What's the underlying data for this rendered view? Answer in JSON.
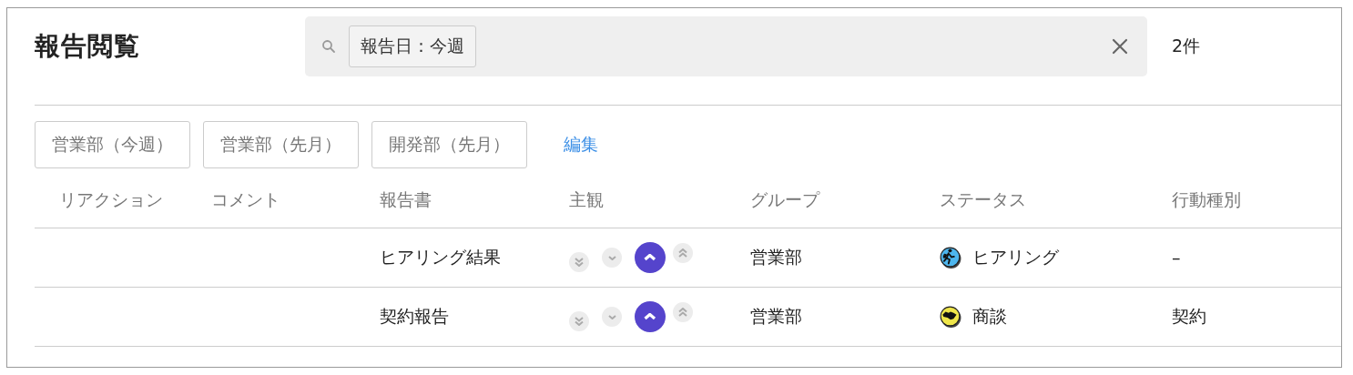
{
  "title": "報告閲覧",
  "search": {
    "chips": [
      "報告日：今週"
    ]
  },
  "result_count": "2件",
  "saved_filters": [
    "営業部（今週）",
    "営業部（先月）",
    "開発部（先月）"
  ],
  "edit_link": "編集",
  "table": {
    "columns": [
      "リアクション",
      "コメント",
      "報告書",
      "主観",
      "グループ",
      "ステータス",
      "行動種別"
    ],
    "rows": [
      {
        "report": "ヒアリング結果",
        "opinion": [
          {
            "kind": "double-down",
            "selected": false
          },
          {
            "kind": "down",
            "selected": false
          },
          {
            "kind": "up",
            "selected": true
          },
          {
            "kind": "double-up",
            "selected": false
          }
        ],
        "group": "営業部",
        "status": {
          "label": "ヒアリング",
          "kind": "runner",
          "color": "#4db6ee"
        },
        "action_type": "–"
      },
      {
        "report": "契約報告",
        "opinion": [
          {
            "kind": "double-down",
            "selected": false
          },
          {
            "kind": "down",
            "selected": false
          },
          {
            "kind": "up",
            "selected": true
          },
          {
            "kind": "double-up",
            "selected": false
          }
        ],
        "group": "営業部",
        "status": {
          "label": "商談",
          "kind": "handshake",
          "color": "#efe64a"
        },
        "action_type": "契約"
      }
    ]
  }
}
